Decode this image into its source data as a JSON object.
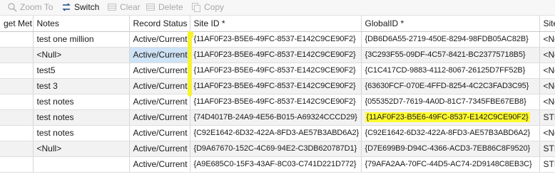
{
  "toolbar": {
    "zoom_label": "Zoom To",
    "switch_label": "Switch",
    "clear_label": "Clear",
    "delete_label": "Delete",
    "copy_label": "Copy"
  },
  "columns": [
    "get Met",
    "Notes",
    "Record Status",
    "Site ID *",
    "GlobalID *",
    "Site"
  ],
  "rows": [
    {
      "col0": "",
      "notes": "test one million",
      "status": "Active/Current",
      "site_id": "{11AF0F23-B5E6-49FC-8537-E142C9CE90F2}",
      "global_id": "{DB6D6A55-2719-450E-8294-98FDB05AC82B}",
      "site": "<No"
    },
    {
      "col0": "",
      "notes": "<Null>",
      "status": "Active/Current",
      "site_id": "{11AF0F23-B5E6-49FC-8537-E142C9CE90F2}",
      "global_id": "{3C293F55-09DF-4C57-8421-BC23775718B5}",
      "site": "<No"
    },
    {
      "col0": "",
      "notes": "test5",
      "status": "Active/Current",
      "site_id": "{11AF0F23-B5E6-49FC-8537-E142C9CE90F2}",
      "global_id": "{C1C417CD-9883-4112-8067-26125D7FF52B}",
      "site": "<No"
    },
    {
      "col0": "",
      "notes": "test 3",
      "status": "Active/Current",
      "site_id": "{11AF0F23-B5E6-49FC-8537-E142C9CE90F2}",
      "global_id": "{63630FCF-070E-4FFD-8254-4C2C3FAD3C95}",
      "site": "<No"
    },
    {
      "col0": "",
      "notes": "test notes",
      "status": "Active/Current",
      "site_id": "{11AF0F23-B5E6-49FC-8537-E142C9CE90F2}",
      "global_id": "{055352D7-7619-4A0D-81C7-7345FBE67EB8}",
      "site": "<No"
    },
    {
      "col0": "",
      "notes": "test notes",
      "status": "Active/Current",
      "site_id": "{74D4017B-24A9-4E56-B015-A69324CCCD29}",
      "global_id": "{11AF0F23-B5E6-49FC-8537-E142C9CE90F2}",
      "site": "STE"
    },
    {
      "col0": "",
      "notes": "test notes",
      "status": "Active/Current",
      "site_id": "{C92E1642-6D32-422A-8FD3-AE57B3ABD6A2}",
      "global_id": "{C92E1642-6D32-422A-8FD3-AE57B3ABD6A2}",
      "site": "<No"
    },
    {
      "col0": "",
      "notes": "<Null>",
      "status": "Active/Current",
      "site_id": "{D9A67670-152C-4C69-94E2-C3DB620787D1}",
      "global_id": "{D7E699B9-D94C-4366-ACD3-7EB86C8F9520}",
      "site": "STE"
    },
    {
      "col0": "",
      "notes": "",
      "status": "Active/Current",
      "site_id": "{A9E685C0-15F3-43AF-8C03-C741D221D772}",
      "global_id": "{79AFA2AA-70FC-44D5-AC74-2D9148C8EB3C}",
      "site": "STE"
    }
  ],
  "colors": {
    "highlight": "#fffb2e",
    "selection": "#cfe3f6",
    "alt_row": "#f2f2f2"
  },
  "icons": [
    "zoom-to-icon",
    "switch-icon",
    "clear-icon",
    "delete-icon",
    "copy-icon"
  ]
}
